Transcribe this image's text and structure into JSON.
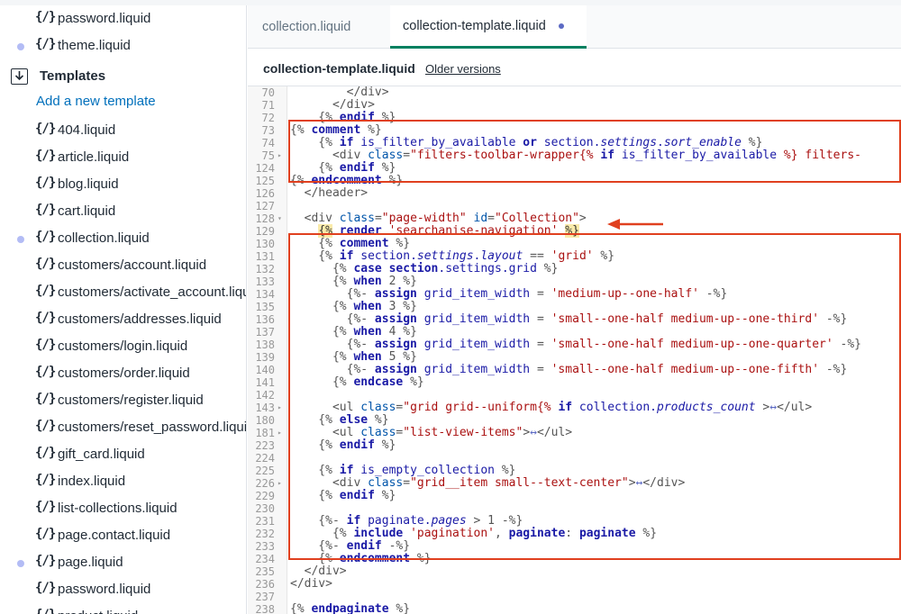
{
  "sidebar": {
    "top_files": [
      {
        "icon": "{/}",
        "name": "password.liquid",
        "modified": false
      },
      {
        "icon": "{/}",
        "name": "theme.liquid",
        "modified": true
      }
    ],
    "templates_folder": {
      "label": "Templates",
      "add_link": "Add a new template"
    },
    "template_files": [
      {
        "icon": "{/}",
        "name": "404.liquid",
        "modified": false
      },
      {
        "icon": "{/}",
        "name": "article.liquid",
        "modified": false
      },
      {
        "icon": "{/}",
        "name": "blog.liquid",
        "modified": false
      },
      {
        "icon": "{/}",
        "name": "cart.liquid",
        "modified": false
      },
      {
        "icon": "{/}",
        "name": "collection.liquid",
        "modified": true
      },
      {
        "icon": "{/}",
        "name": "customers/account.liquid",
        "modified": false
      },
      {
        "icon": "{/}",
        "name": "customers/activate_account.liquid",
        "modified": false
      },
      {
        "icon": "{/}",
        "name": "customers/addresses.liquid",
        "modified": false
      },
      {
        "icon": "{/}",
        "name": "customers/login.liquid",
        "modified": false
      },
      {
        "icon": "{/}",
        "name": "customers/order.liquid",
        "modified": false
      },
      {
        "icon": "{/}",
        "name": "customers/register.liquid",
        "modified": false
      },
      {
        "icon": "{/}",
        "name": "customers/reset_password.liquid",
        "modified": false
      },
      {
        "icon": "{/}",
        "name": "gift_card.liquid",
        "modified": false
      },
      {
        "icon": "{/}",
        "name": "index.liquid",
        "modified": false
      },
      {
        "icon": "{/}",
        "name": "list-collections.liquid",
        "modified": false
      },
      {
        "icon": "{/}",
        "name": "page.contact.liquid",
        "modified": false
      },
      {
        "icon": "{/}",
        "name": "page.liquid",
        "modified": true
      },
      {
        "icon": "{/}",
        "name": "password.liquid",
        "modified": false
      },
      {
        "icon": "{/}",
        "name": "product.liquid",
        "modified": false
      }
    ]
  },
  "tabs": [
    {
      "label": "collection.liquid",
      "active": false
    },
    {
      "label": "collection-template.liquid",
      "active": true
    }
  ],
  "filebar": {
    "name": "collection-template.liquid",
    "older_versions": "Older versions"
  },
  "colors": {
    "accent": "#008060",
    "link": "#006fbb",
    "annotation": "#e0401f",
    "modified_dot": "#b3bcf5"
  },
  "code_lines": [
    {
      "n": "70",
      "fold": "",
      "code": [
        [
          "        </div>",
          "d"
        ]
      ]
    },
    {
      "n": "71",
      "fold": "",
      "code": [
        [
          "      </div>",
          "d"
        ]
      ]
    },
    {
      "n": "72",
      "fold": "",
      "code": [
        [
          "    {% ",
          "d"
        ],
        [
          "endif",
          "k"
        ],
        [
          " %}",
          "d"
        ]
      ]
    },
    {
      "n": "73",
      "fold": "",
      "code": [
        [
          "{% ",
          "d"
        ],
        [
          "comment",
          "k"
        ],
        [
          " %}",
          "d"
        ]
      ]
    },
    {
      "n": "74",
      "fold": "",
      "code": [
        [
          "    {% ",
          "d"
        ],
        [
          "if",
          "k"
        ],
        [
          " is_filter_by_available ",
          "v"
        ],
        [
          "or",
          "k"
        ],
        [
          " section.",
          "v"
        ],
        [
          "settings",
          "i"
        ],
        [
          ".",
          "v"
        ],
        [
          "sort_enable",
          "i"
        ],
        [
          " %}",
          "d"
        ]
      ]
    },
    {
      "n": "75",
      "fold": "▸",
      "code": [
        [
          "      <div ",
          "d"
        ],
        [
          "class",
          "a"
        ],
        [
          "=",
          "d"
        ],
        [
          "\"filters-toolbar-wrapper{% ",
          "s"
        ],
        [
          "if",
          "k"
        ],
        [
          " is_filter_by_available",
          "v"
        ],
        [
          " %} filters-",
          "s"
        ]
      ]
    },
    {
      "n": "124",
      "fold": "",
      "code": [
        [
          "    {% ",
          "d"
        ],
        [
          "endif",
          "k"
        ],
        [
          " %}",
          "d"
        ]
      ]
    },
    {
      "n": "125",
      "fold": "",
      "code": [
        [
          "{% ",
          "d"
        ],
        [
          "endcomment",
          "k"
        ],
        [
          " %}",
          "d"
        ]
      ]
    },
    {
      "n": "126",
      "fold": "",
      "code": [
        [
          "  </header>",
          "d"
        ]
      ]
    },
    {
      "n": "127",
      "fold": "",
      "code": [
        [
          "",
          "d"
        ]
      ]
    },
    {
      "n": "128",
      "fold": "▾",
      "code": [
        [
          "  <div ",
          "d"
        ],
        [
          "class",
          "a"
        ],
        [
          "=",
          "d"
        ],
        [
          "\"page-width\"",
          "s"
        ],
        [
          " ",
          "d"
        ],
        [
          "id",
          "a"
        ],
        [
          "=",
          "d"
        ],
        [
          "\"Collection\"",
          "s"
        ],
        [
          ">",
          "d"
        ]
      ]
    },
    {
      "n": "129",
      "fold": "",
      "code": [
        [
          "    ",
          "d"
        ],
        [
          "{%",
          "h"
        ],
        [
          " ",
          "d"
        ],
        [
          "render",
          "k"
        ],
        [
          " ",
          "d"
        ],
        [
          "'searchanise-navigation'",
          "s"
        ],
        [
          " ",
          "d"
        ],
        [
          "%}",
          "h"
        ]
      ]
    },
    {
      "n": "130",
      "fold": "",
      "code": [
        [
          "    {% ",
          "d"
        ],
        [
          "comment",
          "k"
        ],
        [
          " %}",
          "d"
        ]
      ]
    },
    {
      "n": "131",
      "fold": "",
      "code": [
        [
          "    {% ",
          "d"
        ],
        [
          "if",
          "k"
        ],
        [
          " section.",
          "v"
        ],
        [
          "settings",
          "i"
        ],
        [
          ".",
          "v"
        ],
        [
          "layout",
          "i"
        ],
        [
          " == ",
          "d"
        ],
        [
          "'grid'",
          "s"
        ],
        [
          " %}",
          "d"
        ]
      ]
    },
    {
      "n": "132",
      "fold": "",
      "code": [
        [
          "      {% ",
          "d"
        ],
        [
          "case",
          "k"
        ],
        [
          " ",
          "d"
        ],
        [
          "section",
          "k"
        ],
        [
          ".settings.grid",
          "v"
        ],
        [
          " %}",
          "d"
        ]
      ]
    },
    {
      "n": "133",
      "fold": "",
      "code": [
        [
          "      {% ",
          "d"
        ],
        [
          "when",
          "k"
        ],
        [
          " 2 %}",
          "d"
        ]
      ]
    },
    {
      "n": "134",
      "fold": "",
      "code": [
        [
          "        {%- ",
          "d"
        ],
        [
          "assign",
          "k"
        ],
        [
          " grid_item_width",
          "v"
        ],
        [
          " = ",
          "d"
        ],
        [
          "'medium-up--one-half'",
          "s"
        ],
        [
          " -%}",
          "d"
        ]
      ]
    },
    {
      "n": "135",
      "fold": "",
      "code": [
        [
          "      {% ",
          "d"
        ],
        [
          "when",
          "k"
        ],
        [
          " 3 %}",
          "d"
        ]
      ]
    },
    {
      "n": "136",
      "fold": "",
      "code": [
        [
          "        {%- ",
          "d"
        ],
        [
          "assign",
          "k"
        ],
        [
          " grid_item_width",
          "v"
        ],
        [
          " = ",
          "d"
        ],
        [
          "'small--one-half medium-up--one-third'",
          "s"
        ],
        [
          " -%}",
          "d"
        ]
      ]
    },
    {
      "n": "137",
      "fold": "",
      "code": [
        [
          "      {% ",
          "d"
        ],
        [
          "when",
          "k"
        ],
        [
          " 4 %}",
          "d"
        ]
      ]
    },
    {
      "n": "138",
      "fold": "",
      "code": [
        [
          "        {%- ",
          "d"
        ],
        [
          "assign",
          "k"
        ],
        [
          " grid_item_width",
          "v"
        ],
        [
          " = ",
          "d"
        ],
        [
          "'small--one-half medium-up--one-quarter'",
          "s"
        ],
        [
          " -%}",
          "d"
        ]
      ]
    },
    {
      "n": "139",
      "fold": "",
      "code": [
        [
          "      {% ",
          "d"
        ],
        [
          "when",
          "k"
        ],
        [
          " 5 %}",
          "d"
        ]
      ]
    },
    {
      "n": "140",
      "fold": "",
      "code": [
        [
          "        {%- ",
          "d"
        ],
        [
          "assign",
          "k"
        ],
        [
          " grid_item_width",
          "v"
        ],
        [
          " = ",
          "d"
        ],
        [
          "'small--one-half medium-up--one-fifth'",
          "s"
        ],
        [
          " -%}",
          "d"
        ]
      ]
    },
    {
      "n": "141",
      "fold": "",
      "code": [
        [
          "      {% ",
          "d"
        ],
        [
          "endcase",
          "k"
        ],
        [
          " %}",
          "d"
        ]
      ]
    },
    {
      "n": "142",
      "fold": "",
      "code": [
        [
          "",
          "d"
        ]
      ]
    },
    {
      "n": "143",
      "fold": "▸",
      "code": [
        [
          "      <ul ",
          "d"
        ],
        [
          "class",
          "a"
        ],
        [
          "=",
          "d"
        ],
        [
          "\"grid grid--uniform{% ",
          "s"
        ],
        [
          "if",
          "k"
        ],
        [
          " collection.",
          "v"
        ],
        [
          "products_count",
          "i"
        ],
        [
          " >",
          "d"
        ],
        [
          "↔",
          "f"
        ],
        [
          "</ul>",
          "d"
        ]
      ]
    },
    {
      "n": "180",
      "fold": "",
      "code": [
        [
          "    {% ",
          "d"
        ],
        [
          "else",
          "k"
        ],
        [
          " %}",
          "d"
        ]
      ]
    },
    {
      "n": "181",
      "fold": "▸",
      "code": [
        [
          "      <ul ",
          "d"
        ],
        [
          "class",
          "a"
        ],
        [
          "=",
          "d"
        ],
        [
          "\"list-view-items\"",
          "s"
        ],
        [
          ">",
          "d"
        ],
        [
          "↔",
          "f"
        ],
        [
          "</ul>",
          "d"
        ]
      ]
    },
    {
      "n": "223",
      "fold": "",
      "code": [
        [
          "    {% ",
          "d"
        ],
        [
          "endif",
          "k"
        ],
        [
          " %}",
          "d"
        ]
      ]
    },
    {
      "n": "224",
      "fold": "",
      "code": [
        [
          "",
          "d"
        ]
      ]
    },
    {
      "n": "225",
      "fold": "",
      "code": [
        [
          "    {% ",
          "d"
        ],
        [
          "if",
          "k"
        ],
        [
          " is_empty_collection",
          "v"
        ],
        [
          " %}",
          "d"
        ]
      ]
    },
    {
      "n": "226",
      "fold": "▸",
      "code": [
        [
          "      <div ",
          "d"
        ],
        [
          "class",
          "a"
        ],
        [
          "=",
          "d"
        ],
        [
          "\"grid__item small--text-center\"",
          "s"
        ],
        [
          ">",
          "d"
        ],
        [
          "↔",
          "f"
        ],
        [
          "</div>",
          "d"
        ]
      ]
    },
    {
      "n": "229",
      "fold": "",
      "code": [
        [
          "    {% ",
          "d"
        ],
        [
          "endif",
          "k"
        ],
        [
          " %}",
          "d"
        ]
      ]
    },
    {
      "n": "230",
      "fold": "",
      "code": [
        [
          "",
          "d"
        ]
      ]
    },
    {
      "n": "231",
      "fold": "",
      "code": [
        [
          "    {%- ",
          "d"
        ],
        [
          "if",
          "k"
        ],
        [
          " paginate.",
          "v"
        ],
        [
          "pages",
          "i"
        ],
        [
          " > 1 -%}",
          "d"
        ]
      ]
    },
    {
      "n": "232",
      "fold": "",
      "code": [
        [
          "      {% ",
          "d"
        ],
        [
          "include",
          "k"
        ],
        [
          " ",
          "d"
        ],
        [
          "'pagination'",
          "s"
        ],
        [
          ", ",
          "d"
        ],
        [
          "paginate",
          "k"
        ],
        [
          ": ",
          "d"
        ],
        [
          "paginate",
          "k"
        ],
        [
          " %}",
          "d"
        ]
      ]
    },
    {
      "n": "233",
      "fold": "",
      "code": [
        [
          "    {%- ",
          "d"
        ],
        [
          "endif",
          "k"
        ],
        [
          " -%}",
          "d"
        ]
      ]
    },
    {
      "n": "234",
      "fold": "",
      "code": [
        [
          "    {% ",
          "d"
        ],
        [
          "endcomment",
          "k"
        ],
        [
          " %}",
          "d"
        ]
      ]
    },
    {
      "n": "235",
      "fold": "",
      "code": [
        [
          "  </div>",
          "d"
        ]
      ]
    },
    {
      "n": "236",
      "fold": "",
      "code": [
        [
          "</div>",
          "d"
        ]
      ]
    },
    {
      "n": "237",
      "fold": "",
      "code": [
        [
          "",
          "d"
        ]
      ]
    },
    {
      "n": "238",
      "fold": "",
      "code": [
        [
          "{% ",
          "d"
        ],
        [
          "endpaginate",
          "k"
        ],
        [
          " %}",
          "d"
        ]
      ]
    },
    {
      "n": "239",
      "fold": "",
      "code": [
        [
          "",
          "d"
        ]
      ]
    }
  ]
}
